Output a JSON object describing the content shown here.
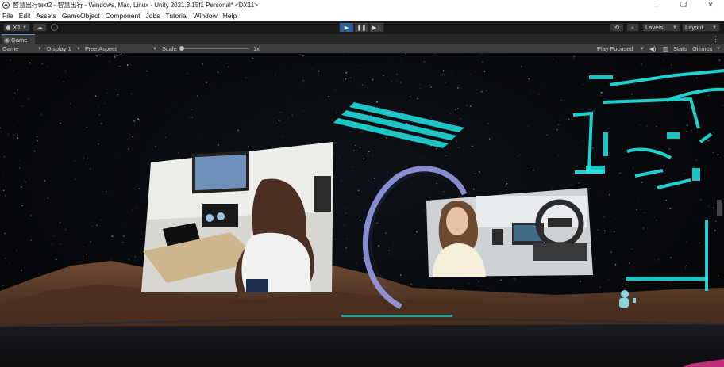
{
  "window": {
    "title": "智慧出行text2 - 智慧出行 - Windows, Mac, Linux - Unity 2021.3.15f1 Personal* <DX11>",
    "controls": [
      "–",
      "❐",
      "✕"
    ]
  },
  "menu": [
    "File",
    "Edit",
    "Assets",
    "GameObject",
    "Component",
    "Jobs",
    "Tutorial",
    "Window",
    "Help"
  ],
  "toolbar": {
    "account": "XJ",
    "layers": "Layers",
    "layout": "Layout"
  },
  "tab": {
    "label": "Game"
  },
  "gamebar": {
    "display_mode": "Game",
    "display": "Display 1",
    "aspect": "Free Aspect",
    "scale_label": "Scale",
    "scale_value": "1x",
    "play_focused": "Play Focused",
    "stats": "Stats",
    "gizmos": "Gizmos"
  },
  "icons": {
    "play": "play-icon",
    "pause": "pause-icon",
    "step": "step-icon",
    "cloud": "cloud-icon",
    "history": "history-icon",
    "search": "search-icon",
    "speaker": "speaker-icon"
  },
  "colors": {
    "accent_cyan": "#22e6e6",
    "play_active": "#2f5f9a",
    "portal": "#8c8fd8",
    "terrain": "#6b4530"
  }
}
